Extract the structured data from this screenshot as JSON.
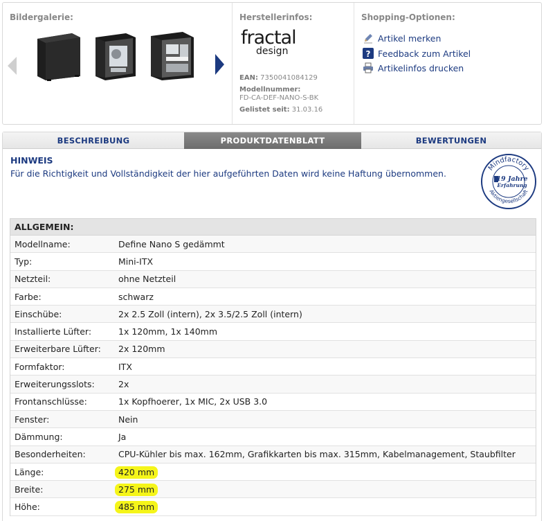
{
  "gallery": {
    "title": "Bildergalerie:"
  },
  "maker": {
    "title": "Herstellerinfos:",
    "logo_line1": "fractal",
    "logo_line2": "design",
    "ean_label": "EAN:",
    "ean_value": "7350041084129",
    "model_label": "Modellnummer:",
    "model_value": "FD-CA-DEF-NANO-S-BK",
    "listed_label": "Gelistet seit:",
    "listed_value": "31.03.16"
  },
  "shop": {
    "title": "Shopping-Optionen:",
    "links": [
      {
        "label": "Artikel merken",
        "icon": "pencil-icon"
      },
      {
        "label": "Feedback zum Artikel",
        "icon": "question-icon"
      },
      {
        "label": "Artikelinfos drucken",
        "icon": "printer-icon"
      }
    ]
  },
  "tabs": [
    {
      "label": "BESCHREIBUNG",
      "active": false
    },
    {
      "label": "PRODUKTDATENBLATT",
      "active": true
    },
    {
      "label": "BEWERTUNGEN",
      "active": false
    }
  ],
  "notice": {
    "title": "HINWEIS",
    "text": "Für die Richtigkeit und Vollständigkeit der hier aufgeführten Daten wird keine Haftung übernommen."
  },
  "seal": {
    "top": "Mindfactory",
    "years": "19 Jahre",
    "sub": "Erfahrung",
    "bottom": "Aktiengesellschaft"
  },
  "spec": {
    "header": "ALLGEMEIN:",
    "rows": [
      {
        "label": "Modellname:",
        "value": "Define Nano S gedämmt"
      },
      {
        "label": "Typ:",
        "value": "Mini-ITX"
      },
      {
        "label": "Netzteil:",
        "value": "ohne Netzteil"
      },
      {
        "label": "Farbe:",
        "value": "schwarz"
      },
      {
        "label": "Einschübe:",
        "value": "2x 2.5 Zoll (intern), 2x 3.5/2.5 Zoll (intern)"
      },
      {
        "label": "Installierte Lüfter:",
        "value": "1x 120mm, 1x 140mm"
      },
      {
        "label": "Erweiterbare Lüfter:",
        "value": "2x 120mm"
      },
      {
        "label": "Formfaktor:",
        "value": "ITX"
      },
      {
        "label": "Erweiterungsslots:",
        "value": "2x"
      },
      {
        "label": "Frontanschlüsse:",
        "value": "1x Kopfhoerer, 1x MIC, 2x USB 3.0"
      },
      {
        "label": "Fenster:",
        "value": "Nein"
      },
      {
        "label": "Dämmung:",
        "value": "Ja"
      },
      {
        "label": "Besonderheiten:",
        "value": "CPU-Kühler bis max. 162mm, Grafikkarten bis max. 315mm, Kabelmanagement, Staubfilter"
      },
      {
        "label": "Länge:",
        "value": "420 mm",
        "highlight": true
      },
      {
        "label": "Breite:",
        "value": "275 mm",
        "highlight": true
      },
      {
        "label": "Höhe:",
        "value": "485 mm",
        "highlight": true
      }
    ]
  },
  "colors": {
    "link": "#1c3a80",
    "highlight": "#f5f51a",
    "tab_active": "#777777"
  }
}
